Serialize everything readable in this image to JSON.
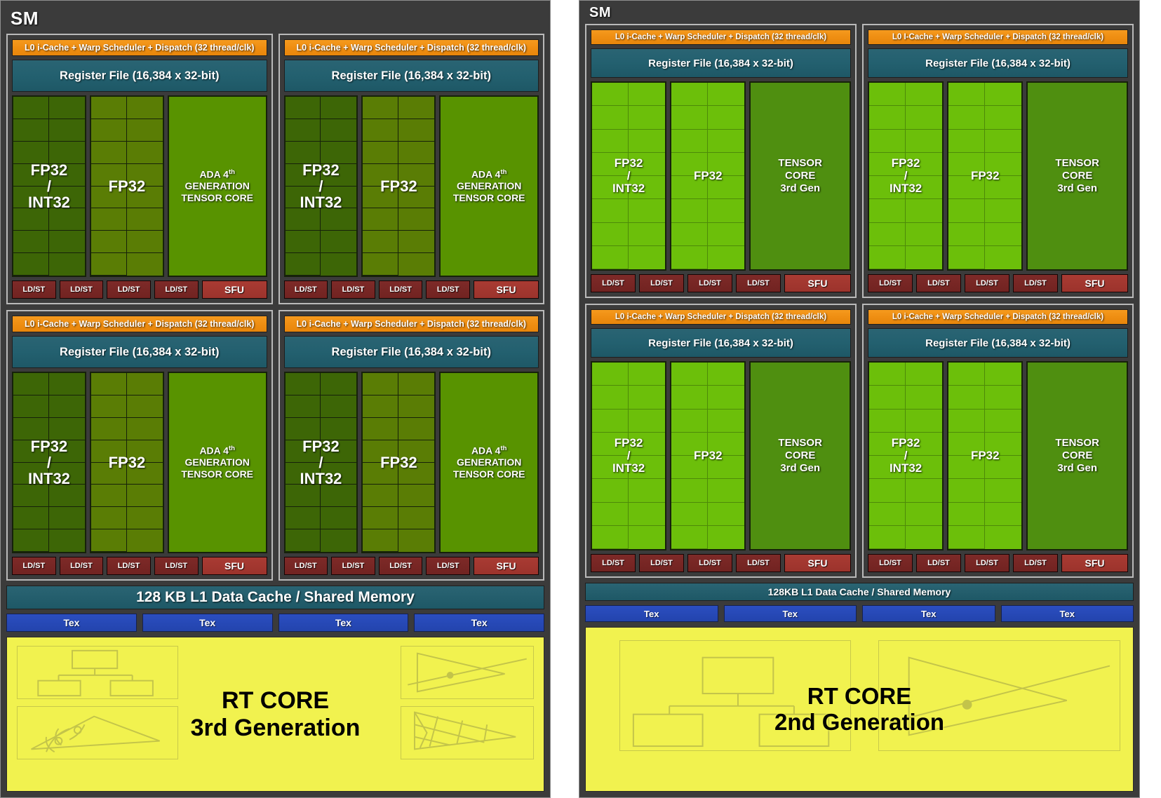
{
  "left_sm": {
    "title": "SM",
    "scheduler_label": "L0 i-Cache + Warp Scheduler + Dispatch (32 thread/clk)",
    "register_file_label": "Register File (16,384 x 32-bit)",
    "fp_int_label_line1": "FP32",
    "fp_int_label_line2": "/",
    "fp_int_label_line3": "INT32",
    "fp32_label": "FP32",
    "tensor_line1": "ADA 4",
    "tensor_line1_sup": "th",
    "tensor_line2": "GENERATION",
    "tensor_line3": "TENSOR CORE",
    "ldst_label": "LD/ST",
    "sfu_label": "SFU",
    "l1_cache_label": "128 KB L1 Data Cache / Shared Memory",
    "tex_label": "Tex",
    "rt_core_line1": "RT CORE",
    "rt_core_line2": "3rd Generation",
    "colors": {
      "scheduler": "#ef8e12",
      "register_file": "#23606f",
      "fp_int_core": "#3d6606",
      "fp32_core": "#5a7d05",
      "tensor_core": "#589300",
      "ldst": "#712321",
      "sfu": "#9c332c",
      "l1_cache": "#1e5866",
      "tex": "#2344ad",
      "rt_core": "#f1f24f",
      "panel_background": "#3b3b3b"
    }
  },
  "right_sm": {
    "title": "SM",
    "scheduler_label": "L0 i-Cache + Warp Scheduler + Dispatch (32 thread/clk)",
    "scheduler_label_alt": "L0 I-Cache + Warp Scheduler + Dispatch (32 thread/clk)",
    "register_file_label": "Register File (16,384 x 32-bit)",
    "fp_int_label_line1": "FP32",
    "fp_int_label_line2": "/",
    "fp_int_label_line3": "INT32",
    "fp32_label": "FP32",
    "tensor_line1": "TENSOR",
    "tensor_line2": "CORE",
    "tensor_line3": "3rd Gen",
    "ldst_label": "LD/ST",
    "sfu_label": "SFU",
    "l1_cache_label": "128KB L1 Data Cache / Shared Memory",
    "tex_label": "Tex",
    "rt_core_line1": "RT CORE",
    "rt_core_line2": "2nd Generation",
    "colors": {
      "scheduler": "#ef8e12",
      "register_file": "#23606f",
      "fp_int_core": "#6cbf0a",
      "fp32_core": "#6cbf0a",
      "tensor_core": "#4f8f10",
      "ldst": "#712321",
      "sfu": "#9c332c",
      "l1_cache": "#1e5866",
      "tex": "#2344ad",
      "rt_core": "#f1f24f",
      "panel_background": "#3b3b3b"
    }
  },
  "structure": {
    "partitions_per_sm": 4,
    "core_rows": 8,
    "core_cols_per_block": 2,
    "ldst_units_per_partition": 4,
    "sfu_per_partition": 1,
    "tex_units": 4
  }
}
